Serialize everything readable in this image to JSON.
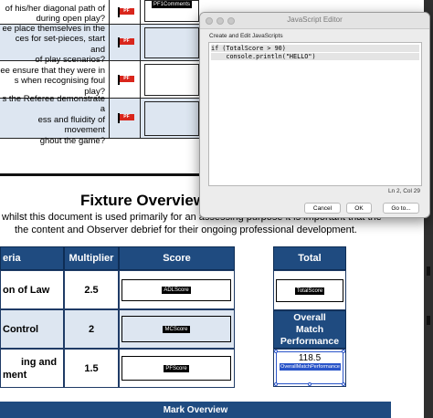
{
  "criteria_rows": [
    {
      "lines": [
        "of his/her diagonal path of",
        "during open play?"
      ],
      "flag": "PF",
      "field": "PF1Comments"
    },
    {
      "lines": [
        "ee place themselves in the",
        "ces for set-pieces, start and",
        "of play scenarios?"
      ],
      "flag": "PF",
      "field": ""
    },
    {
      "lines": [
        "ee ensure that they were in",
        "s when recognising foul play?"
      ],
      "flag": "PF",
      "field": ""
    },
    {
      "lines": [
        "s the Referee demonstrate a",
        "ess and fluidity of movement",
        "ghout the game?"
      ],
      "flag": "PF",
      "field": ""
    }
  ],
  "fixture": {
    "title": "Fixture Overview",
    "para1": "whilst this document is used primarily for an assessing purpose it is important that the",
    "para2": "the content and Observer debrief for their ongoing professional development."
  },
  "table": {
    "headers": {
      "criteria": "eria",
      "multiplier": "Multiplier",
      "score": "Score",
      "total": "Total"
    },
    "rows": [
      {
        "criteria": "on of Law",
        "multiplier": "2.5",
        "field": "ADLScore"
      },
      {
        "criteria": "Control",
        "multiplier": "2",
        "field": "MCScore"
      },
      {
        "criteria_lines": [
          "ing and",
          "ment"
        ],
        "multiplier": "1.5",
        "field": "PFScore"
      }
    ],
    "total_field": "TotalScore",
    "omp": {
      "lines": [
        "Overall",
        "Match",
        "Performance"
      ],
      "value": "118.5",
      "field": "OverallMatchPerformance"
    }
  },
  "mark_overview": "Mark Overview",
  "dialog": {
    "title": "JavaScript Editor",
    "label": "Create and Edit JavaScripts",
    "code": [
      "if (TotalScore > 90)",
      "    console.println(\"HELLO\")"
    ],
    "cursor": "Ln 2, Col 29",
    "buttons": {
      "cancel": "Cancel",
      "ok": "OK",
      "goto": "Go to..."
    }
  },
  "colors": {
    "header_blue": "#1f4b80",
    "row_alt": "#dde6f1",
    "selection": "#2a55c9",
    "flag_red": "#d9261c"
  }
}
